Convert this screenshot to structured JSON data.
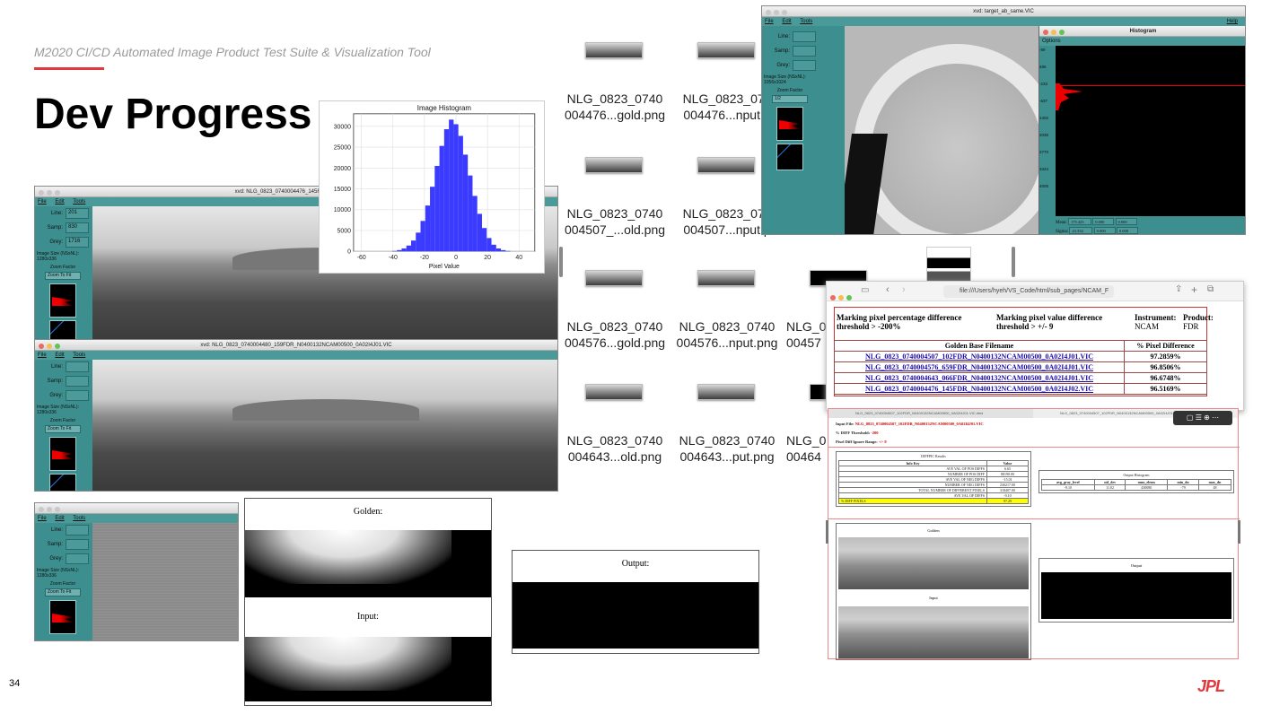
{
  "header": {
    "subtitle": "M2020 CI/CD Automated Image Product Test Suite & Visualization Tool",
    "title": "Dev Progress",
    "page_number": "34",
    "logo_text": "JPL"
  },
  "xvd_window1": {
    "title": "xvd: NLG_0823_0740004476_145FDR_N040013...",
    "menu": [
      "File",
      "Edit",
      "Tools"
    ],
    "line_label": "Line:",
    "line_value": "201",
    "samp_label": "Samp:",
    "samp_value": "830",
    "grey_label": "Grey:",
    "grey_value": "1716",
    "image_size_label": "Image Size (NSxNL):",
    "image_size_value": "1280x336",
    "zoom_label": "Zoom Factor",
    "zoom_value": "Zoom To Fit"
  },
  "xvd_window2": {
    "title": "xvd: NLG_0823_0740004480_159FDR_N0400132NCAM00500_0A02I4J01.VIC",
    "menu": [
      "File",
      "Edit",
      "Tools"
    ],
    "line_label": "Line:",
    "samp_label": "Samp:",
    "grey_label": "Grey:",
    "image_size_label": "Image Size (NSxNL):",
    "image_size_value": "1280x336",
    "zoom_label": "Zoom Factor",
    "zoom_value": "Zoom To Fit"
  },
  "xvd_window3": {
    "menu": [
      "File",
      "Edit",
      "Tools"
    ],
    "line_label": "Line:",
    "samp_label": "Samp:",
    "grey_label": "Grey:",
    "image_size_label": "Image Size (NSxNL):",
    "image_size_value": "1280x336",
    "zoom_label": "Zoom Factor",
    "zoom_value": "Zoom To Fit"
  },
  "xvd_window4": {
    "title": "xvd: target_ab_same.VIC",
    "menu": [
      "File",
      "Edit",
      "Tools"
    ],
    "help": "Help",
    "line_label": "Line:",
    "samp_label": "Samp:",
    "grey_label": "Grey:",
    "image_size_label": "Image Size (NSxNL):",
    "image_size_value": "1056x1024",
    "zoom_label": "Zoom Factor",
    "zoom_value": "1/2",
    "histogram_title": "Histogram",
    "histogram_menu": "Options",
    "yticks": [
      "-89",
      "486",
      "-233",
      "-637",
      "1402",
      "2036",
      "2770",
      "3424",
      "4005"
    ],
    "mean_label": "Mean:",
    "mean_values": [
      "175.425",
      "0.000",
      "0.000"
    ],
    "sigma_label": "Sigma:",
    "sigma_values": [
      "23.334",
      "0.000",
      "0.000"
    ]
  },
  "chart_data": {
    "type": "bar",
    "title": "Image Histogram",
    "xlabel": "Pixel Value",
    "ylabel": "",
    "xlim": [
      -65,
      50
    ],
    "ylim": [
      0,
      33000
    ],
    "xticks": [
      -60,
      -40,
      -20,
      0,
      20,
      40
    ],
    "yticks": [
      0,
      5000,
      10000,
      15000,
      20000,
      25000,
      30000
    ],
    "grid": true,
    "bin_width": 3,
    "x": [
      -39,
      -36,
      -33,
      -30,
      -27,
      -24,
      -21,
      -18,
      -15,
      -12,
      -9,
      -6,
      -3,
      0,
      3,
      6,
      9,
      12,
      15,
      18,
      21,
      24,
      27,
      30,
      33
    ],
    "values": [
      100,
      300,
      700,
      1400,
      2600,
      4500,
      7300,
      11000,
      15500,
      20500,
      25300,
      29300,
      31600,
      30500,
      27700,
      23200,
      18200,
      13300,
      9000,
      5600,
      3200,
      1600,
      700,
      300,
      100
    ],
    "color": "#3b3bff"
  },
  "thumbnails": [
    {
      "label1": "NLG_0823_0740",
      "label2": "004476...gold.png",
      "dark": false
    },
    {
      "label1": "NLG_0823_074",
      "label2": "004476...nput.p",
      "dark": false
    },
    {
      "label1": "NLG_0823_0740",
      "label2": "004507_...old.png",
      "dark": false
    },
    {
      "label1": "NLG_0823_074",
      "label2": "004507...nput.p",
      "dark": false
    },
    {
      "label1": "NLG_0823_0740",
      "label2": "004576...gold.png",
      "dark": false
    },
    {
      "label1": "NLG_0823_0740",
      "label2": "004576...nput.png",
      "dark": false
    },
    {
      "label1": "NLG_0823_0740",
      "label2": "004643...old.png",
      "dark": false
    },
    {
      "label1": "NLG_0823_0740",
      "label2": "004643...put.png",
      "dark": false
    },
    {
      "label1": "NLG_0",
      "label2": "00457",
      "dark": true
    },
    {
      "label1": "NLG_0",
      "label2": "00464",
      "dark": true
    }
  ],
  "browser": {
    "url": "file:///Users/hyeh/VS_Code/html/sub_pages/NCAM_F",
    "col1": "Marking pixel percentage difference threshold > -200%",
    "col2": "Marking pixel value difference threshold > +/- 9",
    "instrument_label": "Instrument:",
    "instrument_value": "NCAM",
    "product_label": "Product:",
    "product_value": "FDR",
    "table_headers": [
      "Golden Base Filename",
      "% Pixel Difference"
    ],
    "rows": [
      {
        "file": "NLG_0823_0740004507_102FDR_N0400132NCAM00500_0A02I4J01.VIC",
        "diff": "97.2859%"
      },
      {
        "file": "NLG_0823_0740004576_659FDR_N0400132NCAM00500_0A02I4J01.VIC",
        "diff": "96.8506%"
      },
      {
        "file": "NLG_0823_0740004643_066FDR_N0400132NCAM00500_0A02I4J01.VIC",
        "diff": "96.6748%"
      },
      {
        "file": "NLG_0823_0740004476_145FDR_N0400132NCAM00500_0A02I4J02.VIC",
        "diff": "96.5169%"
      }
    ]
  },
  "golden_panel": {
    "golden": "Golden:",
    "input": "Input:"
  },
  "output_panel": {
    "output": "Output:"
  },
  "report": {
    "tab1": "NLG_0823_0740004507_102FDR_N0400132NCAM00500_0A02I4J01.VIC.html",
    "tab2": "NLG_0823_0740004507_102FDR_N0400132NCAM00500_0A02I4J01.VIC.html",
    "input_label": "Input File:",
    "input_value": "NLG_0823_0740004507_102FDR_N0400132NCAM00500_0A02I4J01.VIC",
    "threshold_label": "% DIFF Threshold:",
    "threshold_value": "-200",
    "range_label": "Pixel Diff Ignore Range:",
    "range_value": "+/- 9",
    "results_title": "DIFFPIC Results",
    "results_headers": [
      "Info Key",
      "Value"
    ],
    "results": [
      {
        "k": "AVE VAL OF POS DIFFS",
        "v": "6.65"
      },
      {
        "k": "NUMBER OF POS DIFF",
        "v": "88190.00"
      },
      {
        "k": "AVE VAL OF NEG DIFFS",
        "v": "-15.01"
      },
      {
        "k": "NUMBER OF NEG DIFFS",
        "v": "230217.00"
      },
      {
        "k": "TOTAL NUMBER OF DIFFERENT PIXELS",
        "v": "318407.00"
      },
      {
        "k": "AVE VAL OF DIFFS",
        "v": "-9.10"
      },
      {
        "k": "% DIFF PIXELS",
        "v": "97.29"
      }
    ],
    "output_hist_title": "Output Histogram",
    "hist_headers": [
      "avg_gray_level",
      "std_dev",
      "num_elems",
      "min_dn",
      "max_dn"
    ],
    "hist_values": [
      "-9.10",
      "11.02",
      "430080",
      "-79",
      "48"
    ],
    "golden": "Golden",
    "input": "Input",
    "output": "Output"
  }
}
